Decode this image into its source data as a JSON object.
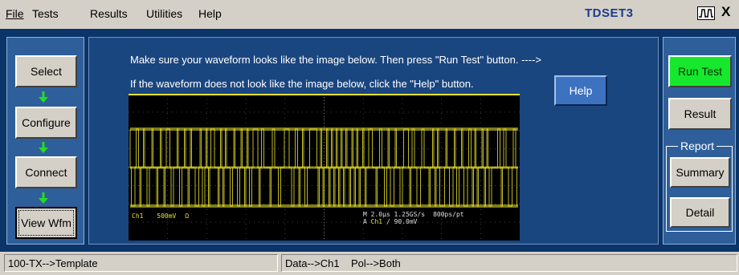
{
  "menu": {
    "items": [
      "File",
      "Tests",
      "Results",
      "Utilities",
      "Help"
    ],
    "app_title": "TDSET3",
    "close_label": "X"
  },
  "workflow": {
    "buttons": [
      "Select",
      "Configure",
      "Connect",
      "View Wfm"
    ],
    "active": "View Wfm",
    "arrow_color": "#22dd22"
  },
  "instructions": {
    "line1": "Make sure your waveform looks like the image below. Then press \"Run Test\" button. ---->",
    "line2": "If the waveform does not look like the image below, click the \"Help\" button.",
    "help_button": "Help"
  },
  "actions": {
    "run_test": "Run Test",
    "result": "Result",
    "report_group": "Report",
    "summary": "Summary",
    "detail": "Detail"
  },
  "scope": {
    "ch_label": "Ch1",
    "volts_div": "500mV",
    "ohm": "Ω",
    "timebase": "M 2.0µs 1.25GS/s",
    "record": "800ps/pt",
    "trigger_prefix": "A",
    "trigger_ch": "Ch1",
    "trigger_slope": "∕",
    "trigger_level": "90.0mV",
    "trace_color": "#e8e22a"
  },
  "status": {
    "left": "100-TX-->Template",
    "right": "Data-->Ch1    Pol-->Both"
  }
}
